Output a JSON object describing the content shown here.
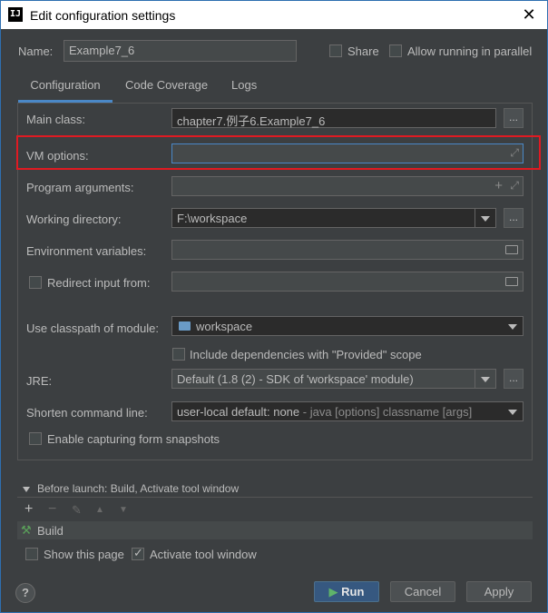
{
  "window": {
    "title": "Edit configuration settings",
    "app_icon": "IJ",
    "close_glyph": "✕"
  },
  "header": {
    "name_label": "Name:",
    "name_value": "Example7_6",
    "share_label": "Share",
    "allow_parallel_label": "Allow running in parallel"
  },
  "tabs": [
    {
      "label": "Configuration",
      "active": true
    },
    {
      "label": "Code Coverage",
      "active": false
    },
    {
      "label": "Logs",
      "active": false
    }
  ],
  "form": {
    "main_class_label": "Main class:",
    "main_class_value": "chapter7.例子6.Example7_6",
    "vm_options_label": "VM options:",
    "vm_options_value": "",
    "program_args_label": "Program arguments:",
    "working_dir_label": "Working directory:",
    "working_dir_value": "F:\\workspace",
    "env_vars_label": "Environment variables:",
    "redirect_input_label": "Redirect input from:",
    "classpath_label": "Use classpath of module:",
    "classpath_value": "workspace",
    "include_deps_label": "Include dependencies with \"Provided\" scope",
    "jre_label": "JRE:",
    "jre_value": "Default (1.8 (2) - SDK of 'workspace' module)",
    "shorten_label": "Shorten command line:",
    "shorten_value": "user-local default: none",
    "shorten_hint": " - java [options] classname [args]",
    "snapshots_label": "Enable capturing form snapshots",
    "ellipsis": "..."
  },
  "before_launch": {
    "header": "Before launch: Build, Activate tool window",
    "toolbar": [
      "+",
      "−",
      "✎",
      "▲",
      "▼"
    ],
    "items": [
      "Build"
    ],
    "show_page_label": "Show this page",
    "activate_tool_label": "Activate tool window",
    "activate_tool_checked": true
  },
  "footer": {
    "help_glyph": "?",
    "run_label": "Run",
    "cancel_label": "Cancel",
    "apply_label": "Apply"
  },
  "colors": {
    "background": "#3c3f41",
    "accent": "#4a88c7",
    "highlight_border": "#e01a22",
    "primary_button": "#365880"
  }
}
